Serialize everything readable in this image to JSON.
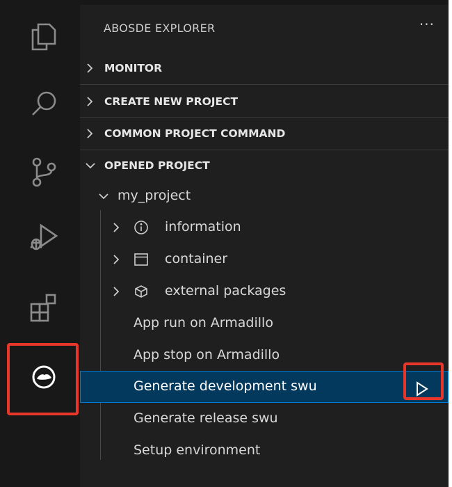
{
  "sidebar": {
    "title": "ABOSDE EXPLORER",
    "more": "···",
    "sections": [
      {
        "label": "MONITOR",
        "expanded": false
      },
      {
        "label": "CREATE NEW PROJECT",
        "expanded": false
      },
      {
        "label": "COMMON PROJECT COMMAND",
        "expanded": false
      },
      {
        "label": "OPENED PROJECT",
        "expanded": true
      }
    ],
    "project": {
      "name": "my_project",
      "folders": [
        {
          "label": "information",
          "icon": "info-icon"
        },
        {
          "label": "container",
          "icon": "window-icon"
        },
        {
          "label": "external packages",
          "icon": "package-icon"
        }
      ],
      "commands": [
        {
          "label": "App run on Armadillo"
        },
        {
          "label": "App stop on Armadillo"
        },
        {
          "label": "Generate development swu",
          "selected": true
        },
        {
          "label": "Generate release swu"
        },
        {
          "label": "Setup environment"
        }
      ]
    }
  },
  "activity_bar": {
    "icons": [
      "files-icon",
      "search-icon",
      "source-control-icon",
      "run-debug-icon",
      "extensions-icon",
      "abosde-icon"
    ],
    "active": "abosde-icon"
  },
  "colors": {
    "selection_bg": "#04395e",
    "selection_border": "#0078d4",
    "highlight_box": "#e8372a"
  }
}
